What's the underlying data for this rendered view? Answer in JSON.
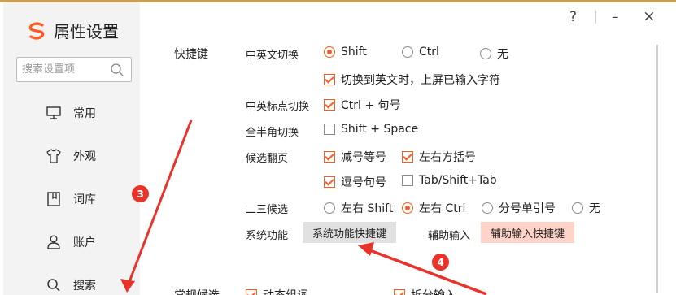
{
  "window": {
    "title": "属性设置",
    "help": "?",
    "minimize": "–",
    "close": "×"
  },
  "search": {
    "placeholder": "搜索设置项"
  },
  "sidebar": {
    "items": [
      {
        "label": "常用",
        "icon": "monitor-icon"
      },
      {
        "label": "外观",
        "icon": "tshirt-icon"
      },
      {
        "label": "词库",
        "icon": "book-icon"
      },
      {
        "label": "账户",
        "icon": "user-icon"
      },
      {
        "label": "搜索",
        "icon": "search-icon"
      }
    ]
  },
  "shortcuts": {
    "section_title": "快捷键",
    "cn_en_switch": {
      "label": "中英文切换",
      "options": [
        {
          "label": "Shift",
          "selected": true
        },
        {
          "label": "Ctrl",
          "selected": false
        },
        {
          "label": "无",
          "selected": false
        }
      ],
      "upload_text": {
        "label": "切换到英文时，上屏已输入字符",
        "checked": true
      }
    },
    "punct_switch": {
      "label": "中英标点切换",
      "option": {
        "label": "Ctrl + 句号",
        "checked": true
      }
    },
    "width_switch": {
      "label": "全半角切换",
      "option": {
        "label": "Shift + Space",
        "checked": false
      }
    },
    "page_turn": {
      "label": "候选翻页",
      "options": [
        {
          "label": "减号等号",
          "checked": true
        },
        {
          "label": "左右方括号",
          "checked": true
        },
        {
          "label": "逗号句号",
          "checked": true
        },
        {
          "label": "Tab/Shift+Tab",
          "checked": false
        }
      ]
    },
    "second_third": {
      "label": "二三候选",
      "options": [
        {
          "label": "左右 Shift",
          "selected": false
        },
        {
          "label": "左右 Ctrl",
          "selected": true
        },
        {
          "label": "分号单引号",
          "selected": false
        },
        {
          "label": "无",
          "selected": false
        }
      ]
    },
    "system": {
      "label": "系统功能",
      "button": "系统功能快捷键"
    },
    "assist": {
      "label": "辅助输入",
      "button": "辅助输入快捷键"
    }
  },
  "next_section": {
    "title": "常规候选",
    "opt1": "动态组词",
    "opt2": "拆分输入"
  },
  "annotations": {
    "a3": "3",
    "a4": "4"
  },
  "colors": {
    "accent": "#ff5a1f",
    "annotation": "#e8322a",
    "assist_button": "#ffd3c8"
  }
}
